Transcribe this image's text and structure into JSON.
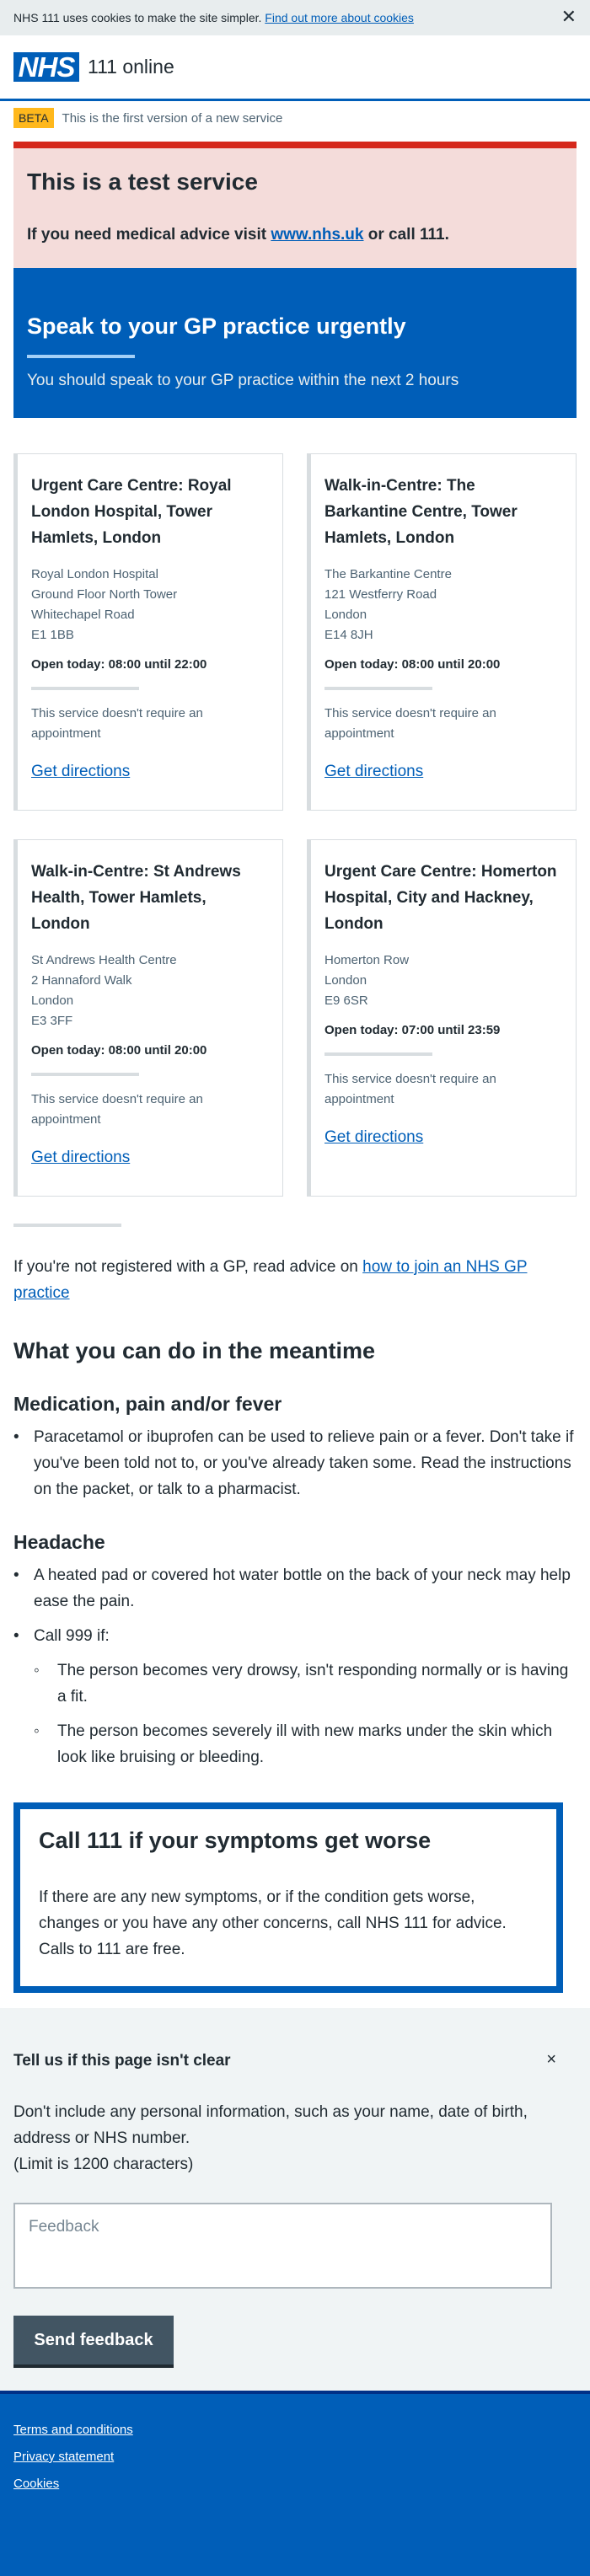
{
  "cookie_banner": {
    "text": "NHS 111 uses cookies to make the site simpler. ",
    "link": "Find out more about cookies",
    "close": "✕"
  },
  "header": {
    "logo": "NHS",
    "service_name": "111 online"
  },
  "beta": {
    "tag": "BETA",
    "text": "This is the first version of a new service"
  },
  "test_service": {
    "title": "This is a test service",
    "text_before": "If you need medical advice visit ",
    "link": "www.nhs.uk",
    "text_after": " or call 111."
  },
  "result": {
    "title": "Speak to your GP practice urgently",
    "subtitle": "You should speak to your GP practice within the next 2 hours"
  },
  "services": [
    {
      "name": "Urgent Care Centre: Royal London Hospital, Tower Hamlets, London",
      "address": [
        "Royal London Hospital",
        "Ground Floor North Tower",
        "Whitechapel Road",
        "E1 1BB"
      ],
      "opening": "Open today: 08:00 until 22:00",
      "appointment": "This service doesn't require an appointment",
      "directions": "Get directions"
    },
    {
      "name": "Walk-in-Centre: The Barkantine Centre, Tower Hamlets, London",
      "address": [
        "The Barkantine Centre",
        "121 Westferry Road",
        "London",
        "E14 8JH"
      ],
      "opening": "Open today: 08:00 until 20:00",
      "appointment": "This service doesn't require an appointment",
      "directions": "Get directions"
    },
    {
      "name": "Walk-in-Centre: St Andrews Health, Tower Hamlets, London",
      "address": [
        "St Andrews Health Centre",
        "2 Hannaford Walk",
        "London",
        "E3 3FF"
      ],
      "opening": "Open today: 08:00 until 20:00",
      "appointment": "This service doesn't require an appointment",
      "directions": "Get directions"
    },
    {
      "name": "Urgent Care Centre: Homerton Hospital, City and Hackney, London",
      "address": [
        "Homerton Row",
        "London",
        "E9 6SR"
      ],
      "opening": "Open today: 07:00 until 23:59",
      "appointment": "This service doesn't require an appointment",
      "directions": "Get directions"
    }
  ],
  "gp_advice": {
    "text": "If you're not registered with a GP, read advice on ",
    "link": "how to join an NHS GP practice"
  },
  "meantime": {
    "title": "What you can do in the meantime",
    "medication": {
      "heading": "Medication, pain and/or fever",
      "items": [
        "Paracetamol or ibuprofen can be used to relieve pain or a fever. Don't take if you've been told not to, or you've already taken some. Read the instructions on the packet, or talk to a pharmacist."
      ]
    },
    "headache": {
      "heading": "Headache",
      "items": [
        "A heated pad or covered hot water bottle on the back of your neck may help ease the pain."
      ],
      "call_999": "Call 999 if:",
      "call_999_items": [
        "The person becomes very drowsy, isn't responding normally or is having a fit.",
        "The person becomes severely ill with new marks under the skin which look like bruising or bleeding."
      ]
    }
  },
  "care_card": {
    "title": "Call 111 if your symptoms get worse",
    "text": "If there are any new symptoms, or if the condition gets worse, changes or you have any other concerns, call NHS 111 for advice. Calls to 111 are free."
  },
  "feedback": {
    "title": "Tell us if this page isn't clear",
    "close": "×",
    "text": "Don't include any personal information, such as your name, date of birth, address or NHS number.",
    "limit": "(Limit is 1200 characters)",
    "placeholder": "Feedback",
    "button": "Send feedback"
  },
  "footer": {
    "links": [
      "Terms and conditions",
      "Privacy statement",
      "Cookies"
    ]
  },
  "colors": {
    "nhs_blue": "#005eb8",
    "emergency_red": "#d5281b",
    "beta_yellow": "#ffb81c",
    "text": "#212b32",
    "secondary_text": "#4c6272",
    "feedback_bg": "#f0f4f5",
    "button_grey": "#425563"
  }
}
